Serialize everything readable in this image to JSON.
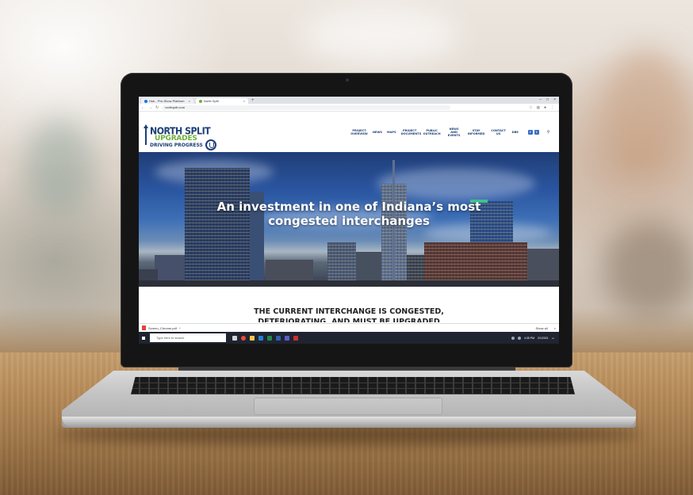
{
  "browser": {
    "tabs": [
      {
        "label": "Hub - Pre-Show Platform"
      },
      {
        "label": "North Split"
      }
    ],
    "new_tab": "+",
    "window_controls": [
      "–",
      "□",
      "×"
    ],
    "address": "northsplit.com"
  },
  "site": {
    "logo": {
      "line1": "NORTH SPLIT",
      "line2": "UPGRADES",
      "line3": "DRIVING PROGRESS"
    },
    "nav": [
      {
        "label": "PROJECT OVERVIEW"
      },
      {
        "label": "NEWS"
      },
      {
        "label": "MAPS"
      },
      {
        "label": "PROJECT DOCUMENTS"
      },
      {
        "label": "PUBLIC OUTREACH"
      },
      {
        "label": "NEWS AND EVENTS"
      },
      {
        "label": "STAY INFORMED"
      },
      {
        "label": "CONTACT US"
      },
      {
        "label": "DBE"
      }
    ],
    "social": [
      {
        "glyph": "f"
      },
      {
        "glyph": "t"
      }
    ],
    "search_glyph": "⚲"
  },
  "hero": {
    "title_line1": "An investment in one of Indiana’s most",
    "title_line2": "congested interchanges"
  },
  "content": {
    "title": "THE CURRENT INTERCHANGE IS CONGESTED,",
    "subtitle": "DETERIORATING, AND MUST BE UPGRADED"
  },
  "download_bar": {
    "file": "Screen_Chrome.pdf",
    "show_all": "Show all"
  },
  "taskbar": {
    "search_placeholder": "Type here to search",
    "time": "4:35 PM",
    "date": "2/1/2021"
  }
}
